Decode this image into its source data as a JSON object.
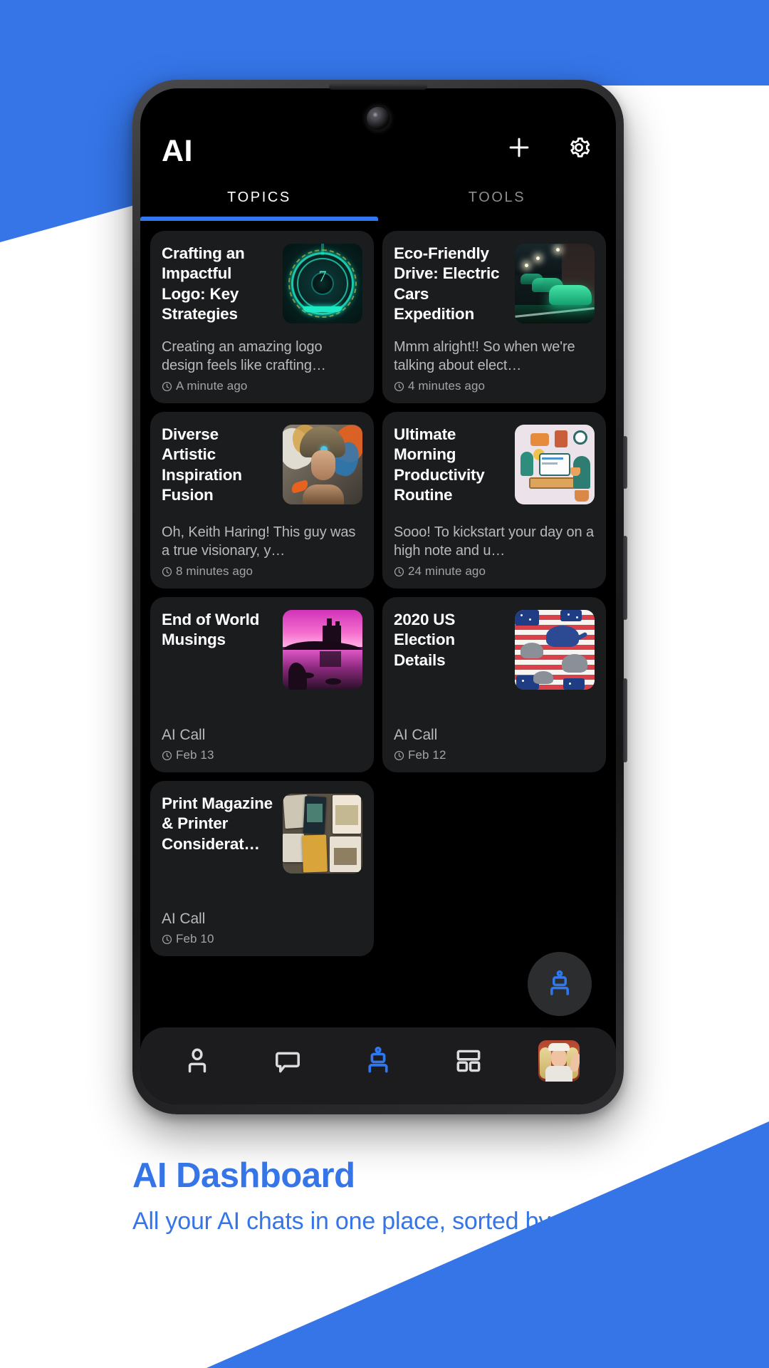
{
  "theme": {
    "brand_blue": "#3575e8",
    "accent_blue": "#2f78f2",
    "card_bg": "#1b1c1e",
    "screen_bg": "#000000",
    "title_color": "#ffffff",
    "body_color": "#b9b9bd"
  },
  "phone": {
    "appbar": {
      "title": "AI",
      "add_icon": "plus-icon",
      "settings_icon": "gear-icon"
    },
    "tabs": [
      {
        "label": "TOPICS",
        "active": true
      },
      {
        "label": "TOOLS",
        "active": false
      }
    ],
    "cards": [
      {
        "title": "Crafting an Impactful Logo: Key Strategies",
        "body": "Creating an amazing logo design feels like crafting…",
        "meta": "A minute ago",
        "meta_icon": "clock-icon",
        "thumb": "circular-tech-emblem-thumbnail"
      },
      {
        "title": "Eco-Friendly Drive: Electric Cars Expedition",
        "body": "Mmm alright!! So when we're talking about elect…",
        "meta": "4 minutes ago",
        "meta_icon": "clock-icon",
        "thumb": "green-electric-cars-night-thumbnail"
      },
      {
        "title": "Diverse Artistic Inspiration Fusion",
        "body": "Oh, Keith Haring! This guy was a true visionary, y…",
        "meta": "8 minutes ago",
        "meta_icon": "clock-icon",
        "thumb": "ornate-portrait-art-thumbnail"
      },
      {
        "title": "Ultimate Morning Productivity Routine",
        "body": "Sooo! To kickstart your day on a high note and u…",
        "meta": "24 minute ago",
        "meta_icon": "clock-icon",
        "thumb": "desk-workspace-illustration-thumbnail"
      },
      {
        "title": "End of World Musings",
        "subtitle": "AI Call",
        "meta": "Feb 13",
        "meta_icon": "clock-icon",
        "thumb": "pink-sunset-castle-lake-thumbnail"
      },
      {
        "title": "2020 US Election Details",
        "subtitle": "AI Call",
        "meta": "Feb 12",
        "meta_icon": "clock-icon",
        "thumb": "us-flag-elephants-pattern-thumbnail"
      },
      {
        "title": "Print Magazine & Printer Considerat…",
        "subtitle": "AI Call",
        "meta": "Feb 10",
        "meta_icon": "clock-icon",
        "thumb": "magazine-spread-photo-thumbnail"
      }
    ],
    "fab": {
      "icon": "robot-icon"
    },
    "bottom_nav": [
      {
        "icon": "person-icon",
        "active": false
      },
      {
        "icon": "chat-bubble-icon",
        "active": false
      },
      {
        "icon": "robot-icon",
        "active": true
      },
      {
        "icon": "dashboard-grid-icon",
        "active": false
      },
      {
        "icon": "avatar-photo",
        "active": false
      }
    ]
  },
  "promo": {
    "title": "AI Dashboard",
    "subtitle": "All your AI chats in one place, sorted by topic"
  }
}
